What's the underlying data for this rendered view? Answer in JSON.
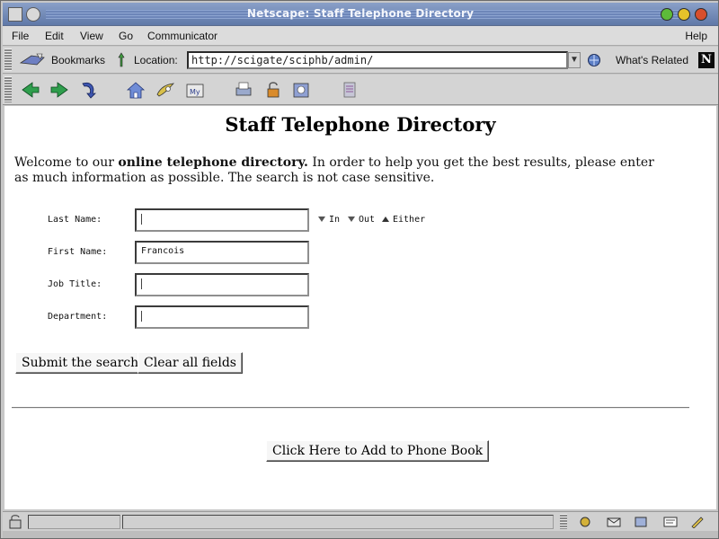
{
  "window": {
    "title": "Netscape: Staff Telephone Directory"
  },
  "menubar": {
    "file": "File",
    "edit": "Edit",
    "view": "View",
    "go": "Go",
    "communicator": "Communicator",
    "help": "Help"
  },
  "location_bar": {
    "bookmarks": "Bookmarks",
    "location_label": "Location:",
    "url": "http://scigate/sciphb/admin/",
    "whats_related": "What's Related"
  },
  "page": {
    "heading": "Staff Telephone Directory",
    "intro_start": "Welcome to our ",
    "intro_bold": "online telephone directory.",
    "intro_rest": "  In order to help you get the best results, please enter as much information as possible.  The search is not case sensitive."
  },
  "form": {
    "last_name_label": "Last Name:",
    "last_name_value": "",
    "first_name_label": "First Name:",
    "first_name_value": "Francois",
    "job_title_label": "Job Title:",
    "job_title_value": "",
    "department_label": "Department:",
    "department_value": "",
    "radio_in": "In",
    "radio_out": "Out",
    "radio_either": "Either",
    "selected_radio": "Either",
    "submit_label": "Submit the search",
    "clear_label": "Clear all fields",
    "add_label": "Click Here to Add to Phone Book"
  },
  "colors": {
    "titlebar": "#6f88b8",
    "chrome": "#d4d4d4",
    "page_background": "#ffffff"
  }
}
